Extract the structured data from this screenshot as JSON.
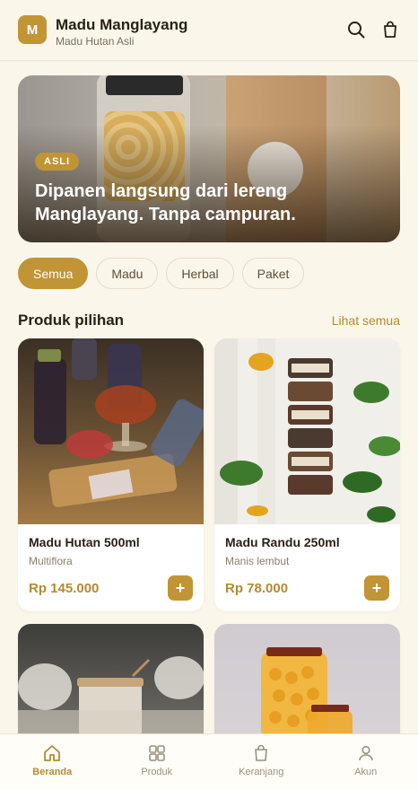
{
  "colors": {
    "accent": "#C19436",
    "price": "#B48A2F",
    "background": "#FBF6EA"
  },
  "header": {
    "logo_letter": "M",
    "title": "Madu Manglayang",
    "subtitle": "Madu Hutan Asli",
    "icons": [
      "search-icon",
      "shopping-bag-icon"
    ]
  },
  "hero": {
    "badge": "ASLI",
    "text": "Dipanen langsung dari lereng Manglayang. Tanpa campuran."
  },
  "chips": [
    {
      "label": "Semua",
      "active": true
    },
    {
      "label": "Madu",
      "active": false
    },
    {
      "label": "Herbal",
      "active": false
    },
    {
      "label": "Paket",
      "active": false
    }
  ],
  "section": {
    "title": "Produk pilihan",
    "link": "Lihat semua"
  },
  "products": [
    {
      "name": "Madu Hutan 500ml",
      "variant": "Multiflora",
      "price": "Rp 145.000",
      "add": "+"
    },
    {
      "name": "Madu Randu 250ml",
      "variant": "Manis lembut",
      "price": "Rp 78.000",
      "add": "+"
    },
    {
      "name": "",
      "variant": "",
      "price": "",
      "add": ""
    },
    {
      "name": "",
      "variant": "",
      "price": "",
      "add": ""
    }
  ],
  "nav": [
    {
      "label": "Beranda",
      "icon": "home-icon",
      "active": true
    },
    {
      "label": "Produk",
      "icon": "grid-icon",
      "active": false
    },
    {
      "label": "Keranjang",
      "icon": "bag-icon",
      "active": false
    },
    {
      "label": "Akun",
      "icon": "user-icon",
      "active": false
    }
  ]
}
